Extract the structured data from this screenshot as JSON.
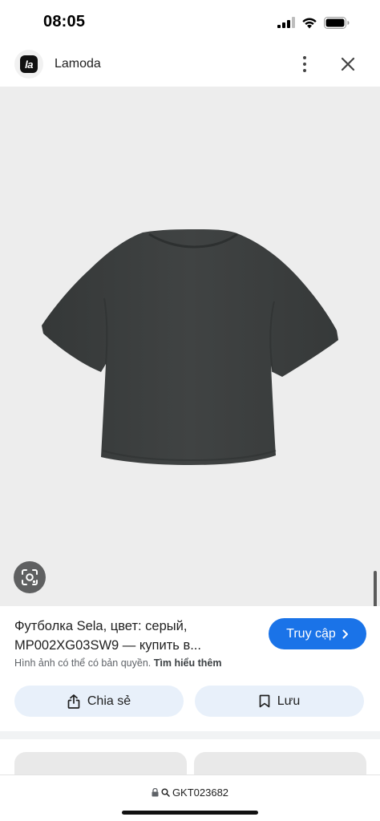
{
  "status_bar": {
    "time": "08:05"
  },
  "header": {
    "site_name": "Lamoda",
    "logo_text": "la"
  },
  "product": {
    "title_line1": "Футболка Sela, цвет: серый,",
    "title_line2": "MP002XG03SW9 — купить в...",
    "visit_label": "Truy cập",
    "copyright_text": "Hình ảnh có thể có bản quyền.",
    "learn_more": "Tìm hiểu thêm"
  },
  "actions": {
    "share_label": "Chia sẻ",
    "save_label": "Lưu"
  },
  "url_bar": {
    "url": "GKT023682"
  },
  "colors": {
    "accent": "#1a73e8",
    "image_bg": "#ededed",
    "tshirt": "#3c3f3f",
    "action_bg": "#e8f0fa"
  },
  "icons": [
    "cellular-signal-icon",
    "wifi-icon",
    "battery-icon",
    "more-vert-icon",
    "close-icon",
    "lens-icon",
    "chevron-right-icon",
    "share-icon",
    "bookmark-icon",
    "lock-icon",
    "search-icon"
  ]
}
